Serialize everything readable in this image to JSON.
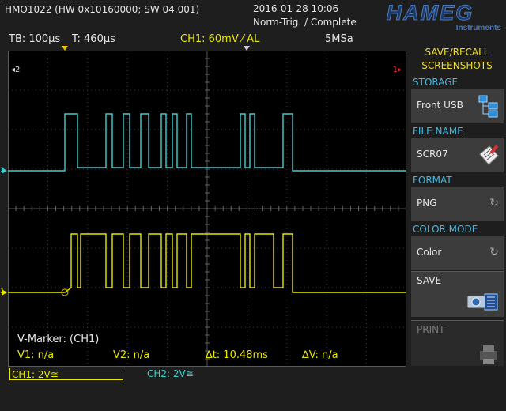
{
  "header": {
    "model": "HMO1022 (HW 0x10160000; SW 04.001)",
    "datetime": "2016-01-28 10:06",
    "trigger_status": "Norm-Trig. / Complete",
    "brand": "HAMEG",
    "brand_sub": "Instruments"
  },
  "info_bar": {
    "timebase": "TB: 100µs",
    "trigger_time": "T: 460µs",
    "ch1_trigger": "CH1: 60mV ⁄ AL",
    "sample_rate": "5MSa"
  },
  "screen": {
    "ch2_marker": "◂2",
    "ch1_marker_top": "1▸",
    "vmarker": {
      "title": "V-Marker: (CH1)",
      "v1": "V1: n/a",
      "v2": "V2: n/a",
      "dt": "∆t: 10.48ms",
      "dv": "∆V: n/a"
    }
  },
  "channels": {
    "ch1_scale": "CH1: 2V≅",
    "ch2_scale": "CH2: 2V≅",
    "ch1_color": "#e8e800",
    "ch2_color": "#3fd0d0"
  },
  "softmenu": {
    "title_line1": "SAVE/RECALL",
    "title_line2": "SCREENSHOTS",
    "storage_label": "STORAGE",
    "storage_value": "Front USB",
    "filename_label": "FILE NAME",
    "filename_value": "SCR07",
    "format_label": "FORMAT",
    "format_value": "PNG",
    "colormode_label": "COLOR MODE",
    "colormode_value": "Color",
    "save_label": "SAVE",
    "print_label": "PRINT"
  }
}
